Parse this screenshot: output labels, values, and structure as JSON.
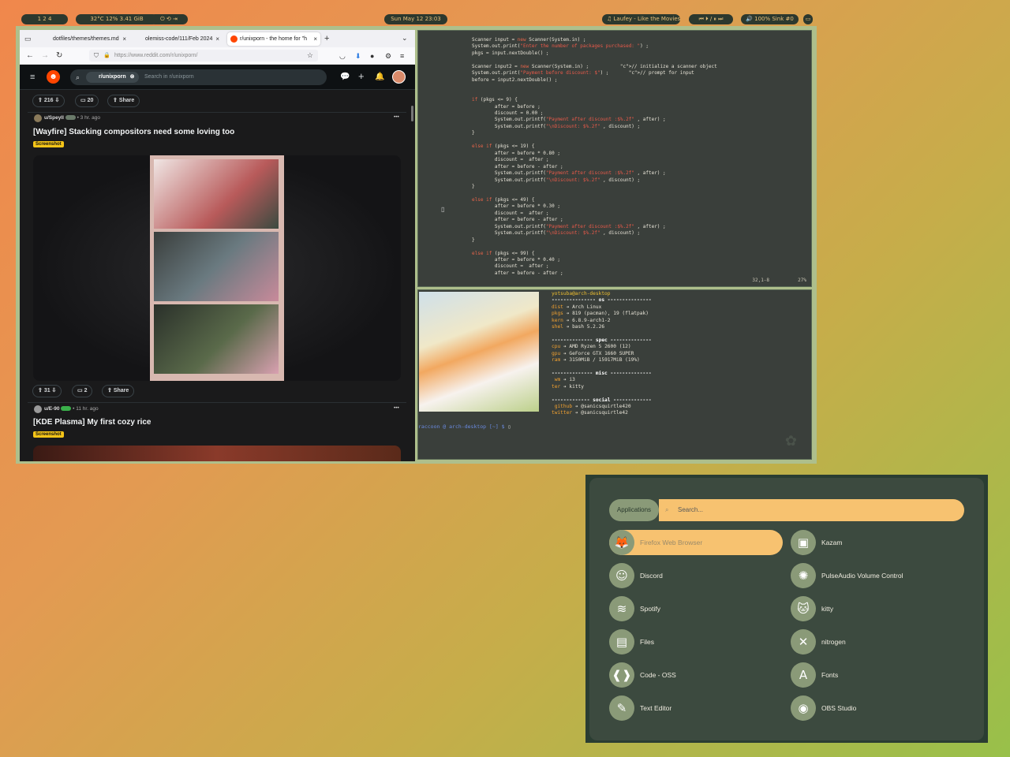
{
  "statusbar": {
    "workspaces": "1  2  4",
    "system": "32°C  12%  3.41 GiB",
    "controls": "⏻  ⟲  ⇥",
    "clock": "Sun May 12 23:03",
    "music": "♫ Laufey - Like the Movies",
    "media": "⏮ ⏵ / ⏸ ⏭",
    "volume": "🔊 100% Sink #0",
    "tray": "▭"
  },
  "browser": {
    "tabs": [
      {
        "label": "dotfiles/themes/themes.md"
      },
      {
        "label": "olemiss-code/111/Feb 2024"
      },
      {
        "label": "r/unixporn - the home for \"h"
      }
    ],
    "url": "https://www.reddit.com/r/unixporn/",
    "reddit": {
      "subreddit_chip": "r/unixporn",
      "search_placeholder": "Search in r/unixporn",
      "post0": {
        "upvotes": "216",
        "comments": "20",
        "share": "Share"
      },
      "post1": {
        "author": "u/Speyll",
        "time": "• 3 hr. ago",
        "title": "[Wayfire] Stacking compositors need some loving too",
        "flair": "Screenshot",
        "upvotes": "31",
        "comments": "2",
        "share": "Share",
        "more": "•••"
      },
      "post2": {
        "author": "u/E-90",
        "time": "• 11 hr. ago",
        "title": "[KDE Plasma] My first cozy rice",
        "flair": "Screenshot",
        "more": "•••"
      }
    }
  },
  "editor": {
    "lines": [
      "Scanner input = new Scanner(System.in) ;",
      "System.out.print(\"Enter the number of packages purchased: \") ;",
      "pkgs = input.nextDouble() ;",
      "",
      "Scanner input2 = new Scanner(System.in) ;           // initialize a scanner object",
      "System.out.print(\"Payment before discount: $\") ;       // prompt for input",
      "before = input2.nextDouble() ;",
      "",
      "",
      "if (pkgs <= 9) {",
      "        after = before ;",
      "        discount = 0.00 ;",
      "        System.out.printf(\"Payment after discount :$%.2f\" , after) ;",
      "        System.out.printf(\"\\nDiscount: $%.2f\" , discount) ;",
      "}",
      "",
      "else if (pkgs <= 19) {",
      "        after = before * 0.80 ;",
      "        discount =  after ;",
      "        after = before - after ;",
      "        System.out.printf(\"Payment after discount :$%.2f\" , after) ;",
      "        System.out.printf(\"\\nDiscount: $%.2f\" , discount) ;",
      "}",
      "",
      "else if (pkgs <= 49) {",
      "        after = before * 0.30 ;",
      "        discount =  after ;",
      "        after = before - after ;",
      "        System.out.printf(\"Payment after discount :$%.2f\" , after) ;",
      "        System.out.printf(\"\\nDiscount: $%.2f\" , discount) ;",
      "}",
      "",
      "else if (pkgs <= 99) {",
      "        after = before * 0.40 ;",
      "        discount =  after ;",
      "        after = before - after ;"
    ],
    "status": "32,1-8          27%"
  },
  "terminal": {
    "user": "yotsuba",
    "host": "@arch-desktop",
    "os_header": "--------------- os ---------------",
    "os": [
      [
        "dist",
        "Arch Linux"
      ],
      [
        "pkgs",
        "819 (pacman), 19 (flatpak)"
      ],
      [
        "kern",
        "6.8.9-arch1-2"
      ],
      [
        "shel",
        "bash 5.2.26"
      ]
    ],
    "spec_header": "-------------- spec --------------",
    "spec": [
      [
        "cpu",
        "AMD Ryzen 5 2600 (12)"
      ],
      [
        "gpu",
        "GeForce GTX 1660 SUPER"
      ],
      [
        "ram",
        "3150MiB / 15917MiB (19%)"
      ]
    ],
    "misc_header": "-------------- misc --------------",
    "misc": [
      [
        " wm",
        "i3"
      ],
      [
        "ter",
        "kitty"
      ]
    ],
    "social_header": "------------- social -------------",
    "social": [
      [
        " github",
        "@sanicsquirtle420"
      ],
      [
        "twitter",
        "@sanicsquirtle42"
      ]
    ],
    "prompt": "raccoon @ arch-desktop [~] $ ",
    "arrow": "➔"
  },
  "launcher": {
    "mode": "Applications",
    "search_placeholder": "Search...",
    "left": [
      {
        "label": "Firefox Web Browser",
        "icon": "firefox-icon",
        "glyph": "🦊"
      },
      {
        "label": "Discord",
        "icon": "discord-icon",
        "glyph": "☺"
      },
      {
        "label": "Spotify",
        "icon": "spotify-icon",
        "glyph": "≋"
      },
      {
        "label": "Files",
        "icon": "files-icon",
        "glyph": "▤"
      },
      {
        "label": "Code - OSS",
        "icon": "code-icon",
        "glyph": "❰❱"
      },
      {
        "label": "Text Editor",
        "icon": "text-editor-icon",
        "glyph": "✎"
      }
    ],
    "right": [
      {
        "label": "Kazam",
        "icon": "kazam-icon",
        "glyph": "▣"
      },
      {
        "label": "PulseAudio Volume Control",
        "icon": "pulseaudio-icon",
        "glyph": "✺"
      },
      {
        "label": "kitty",
        "icon": "kitty-icon",
        "glyph": "🐱"
      },
      {
        "label": "nitrogen",
        "icon": "nitrogen-icon",
        "glyph": "✕"
      },
      {
        "label": "Fonts",
        "icon": "fonts-icon",
        "glyph": "A"
      },
      {
        "label": "OBS Studio",
        "icon": "obs-icon",
        "glyph": "◉"
      }
    ]
  }
}
